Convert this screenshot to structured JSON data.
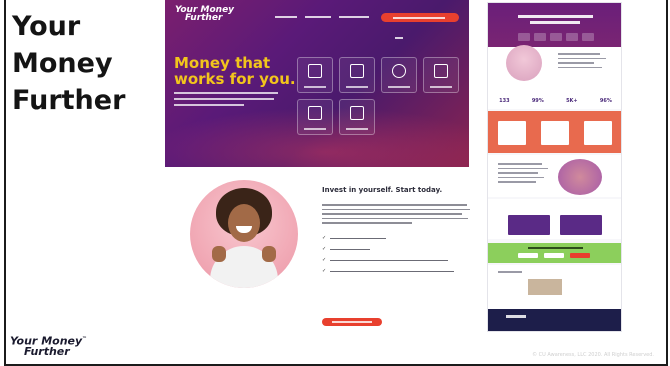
{
  "slide": {
    "title": "Your Money Further",
    "copyright": "© CU Awareness, LLC 2020. All Rights Reserved."
  },
  "brand": {
    "line1": "Your Money",
    "line2": "Further",
    "trademark": "™"
  },
  "hero": {
    "logo_line1": "Your Money",
    "logo_line2": "Further",
    "headline": "Money that works for you.",
    "headline_line1": "Money that",
    "headline_line2": "works for you."
  },
  "middle": {
    "heading": "Invest in yourself. Start today."
  },
  "right_page": {
    "stats": [
      "133",
      "99%",
      "5K+",
      "96%"
    ]
  },
  "colors": {
    "hero_purple": "#5a1a78",
    "hero_magenta": "#8a2450",
    "headline_yellow": "#f2c51c",
    "cta_red": "#e8402e",
    "orange_band": "#e86a4e",
    "green_band": "#8ccf5c",
    "footer_navy": "#1d1e4a"
  }
}
